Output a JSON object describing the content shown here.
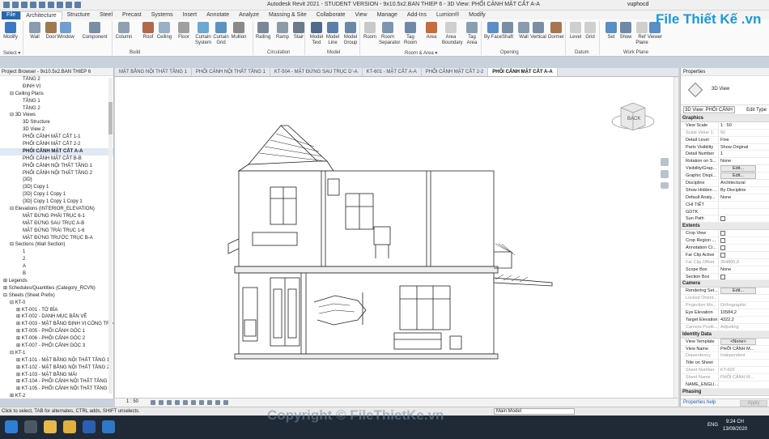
{
  "window": {
    "title": "Autodesk Revit 2021 - STUDENT VERSION - 9x10.5x2.BAN THIEP 6 - 3D View: PHỐI CẢNH MẶT CẮT A-A",
    "user": "vuphocd"
  },
  "ribbon": {
    "tabs": [
      "File",
      "Architecture",
      "Structure",
      "Steel",
      "Precast",
      "Systems",
      "Insert",
      "Annotate",
      "Analyze",
      "Massing & Site",
      "Collaborate",
      "View",
      "Manage",
      "Add-Ins",
      "Lumion®",
      "Modify"
    ],
    "active_tab": "Architecture",
    "buttons": [
      {
        "label": "Modify",
        "color": "#3b78c4"
      },
      {
        "label": "Wall",
        "color": "#8a9bb0"
      },
      {
        "label": "Door",
        "color": "#a07a4e"
      },
      {
        "label": "Window",
        "color": "#6e9fd0"
      },
      {
        "label": "Component",
        "color": "#7a8fa6"
      },
      {
        "label": "Column",
        "color": "#8fa0b3"
      },
      {
        "label": "Roof",
        "color": "#b06a4a"
      },
      {
        "label": "Ceiling",
        "color": "#9ab0c6"
      },
      {
        "label": "Floor",
        "color": "#a0a0a0"
      },
      {
        "label": "Curtain System",
        "color": "#6aa8d6"
      },
      {
        "label": "Curtain Grid",
        "color": "#5c93c2"
      },
      {
        "label": "Mullion",
        "color": "#8a8a8a"
      },
      {
        "label": "Railing",
        "color": "#7b8797"
      },
      {
        "label": "Ramp",
        "color": "#8d9aa8"
      },
      {
        "label": "Stair",
        "color": "#6b7b8d"
      },
      {
        "label": "Model Text",
        "color": "#4f6a8a"
      },
      {
        "label": "Model Line",
        "color": "#5b7fa8"
      },
      {
        "label": "Model Group",
        "color": "#6c88a8"
      },
      {
        "label": "Room",
        "color": "#c9c9c9"
      },
      {
        "label": "Room Separator",
        "color": "#7d95b0"
      },
      {
        "label": "Tag Room",
        "color": "#6f8aa9"
      },
      {
        "label": "Area",
        "color": "#c96a3a"
      },
      {
        "label": "Area Boundary",
        "color": "#cfcfcf"
      },
      {
        "label": "Tag Area",
        "color": "#8a9fb6"
      },
      {
        "label": "By Face",
        "color": "#5a8ec6"
      },
      {
        "label": "Shaft",
        "color": "#7a8fa6"
      },
      {
        "label": "Wall",
        "color": "#8a9bb0"
      },
      {
        "label": "Vertical",
        "color": "#7a8fa6"
      },
      {
        "label": "Dormer",
        "color": "#a9754f"
      },
      {
        "label": "Level",
        "color": "#cfcfcf"
      },
      {
        "label": "Grid",
        "color": "#cfcfcf"
      },
      {
        "label": "Set",
        "color": "#5a8ec6"
      },
      {
        "label": "Show",
        "color": "#6f8aa9"
      },
      {
        "label": "Ref Plane",
        "color": "#cfcfcf"
      },
      {
        "label": "Viewer",
        "color": "#5a8ec6"
      }
    ],
    "panels": [
      "Select ▾",
      "Build",
      "Circulation",
      "Model",
      "Room & Area ▾",
      "Opening",
      "Datum",
      "Work Plane"
    ]
  },
  "project_browser": {
    "title": "Project Browser - 9x10.5x2.BAN THIEP 6",
    "items": [
      {
        "text": "TẦNG 2",
        "indent": 3
      },
      {
        "text": "ĐỊNH VỊ",
        "indent": 3
      },
      {
        "text": "⊟ Ceiling Plans",
        "indent": 1
      },
      {
        "text": "TẦNG 1",
        "indent": 3
      },
      {
        "text": "TẦNG 2",
        "indent": 3
      },
      {
        "text": "⊟ 3D Views",
        "indent": 1
      },
      {
        "text": "3D Structure",
        "indent": 3
      },
      {
        "text": "3D View 2",
        "indent": 3
      },
      {
        "text": "PHỐI CẢNH MẶT CẮT 1-1",
        "indent": 3
      },
      {
        "text": "PHỐI CẢNH MẶT CẮT 2-2",
        "indent": 3
      },
      {
        "text": "PHỐI CẢNH MẶT CẮT A-A",
        "indent": 3,
        "selected": true
      },
      {
        "text": "PHỐI CẢNH MẶT CẮT B-B",
        "indent": 3
      },
      {
        "text": "PHỐI CẢNH NỘI THẤT TẦNG 1",
        "indent": 3
      },
      {
        "text": "PHỐI CẢNH NỘI THẤT TẦNG 2",
        "indent": 3
      },
      {
        "text": "{3D}",
        "indent": 3
      },
      {
        "text": "{3D} Copy 1",
        "indent": 3
      },
      {
        "text": "{3D} Copy 1 Copy 1",
        "indent": 3
      },
      {
        "text": "{3D} Copy 1 Copy 1 Copy 1",
        "indent": 3
      },
      {
        "text": "⊟ Elevations (INTERIOR_ELEVATION)",
        "indent": 1
      },
      {
        "text": "MẶT ĐỨNG PHẢI TRỤC 6-1",
        "indent": 3
      },
      {
        "text": "MẶT ĐỨNG SAU TRỤC A-B",
        "indent": 3
      },
      {
        "text": "MẶT ĐỨNG TRÁI TRỤC 1-6",
        "indent": 3
      },
      {
        "text": "MẶT ĐỨNG TRƯỚC TRỤC B-A",
        "indent": 3
      },
      {
        "text": "⊟ Sections (Wall Section)",
        "indent": 1
      },
      {
        "text": "1",
        "indent": 3
      },
      {
        "text": "2",
        "indent": 3
      },
      {
        "text": "A",
        "indent": 3
      },
      {
        "text": "B",
        "indent": 3
      },
      {
        "text": "⊞ Legends",
        "indent": 0
      },
      {
        "text": "⊞ Schedules/Quantities (Category_RCVN)",
        "indent": 0
      },
      {
        "text": "⊟ Sheets (Sheet Prefix)",
        "indent": 0
      },
      {
        "text": "⊟ KT-0",
        "indent": 1
      },
      {
        "text": "⊞ KT-001 - TỜ BÌA",
        "indent": 2
      },
      {
        "text": "⊞ KT-002 - DANH MỤC BẢN VẼ",
        "indent": 2
      },
      {
        "text": "⊞ KT-003 - MẶT BẰNG ĐỊNH VỊ CÔNG TRÌNH",
        "indent": 2
      },
      {
        "text": "⊞ KT-005 - PHỐI CẢNH GÓC 1",
        "indent": 2
      },
      {
        "text": "⊞ KT-006 - PHỐI CẢNH GÓC 2",
        "indent": 2
      },
      {
        "text": "⊞ KT-007 - PHỐI CẢNH GÓC 3",
        "indent": 2
      },
      {
        "text": "⊟ KT-1",
        "indent": 1
      },
      {
        "text": "⊞ KT-101 - MẶT BẰNG NỘI THẤT TẦNG 1",
        "indent": 2
      },
      {
        "text": "⊞ KT-102 - MẶT BẰNG NỘI THẤT TẦNG 2",
        "indent": 2
      },
      {
        "text": "⊞ KT-103 - MẶT BẰNG MÁI",
        "indent": 2
      },
      {
        "text": "⊞ KT-104 - PHỐI CẢNH NỘI THẤT TẦNG 1",
        "indent": 2
      },
      {
        "text": "⊞ KT-105 - PHỐI CẢNH NỘI THẤT TẦNG 2",
        "indent": 2
      },
      {
        "text": "⊞ KT-2",
        "indent": 1
      }
    ]
  },
  "view_tabs": [
    {
      "label": "MẶT BẰNG NỘI THẤT TẦNG 1",
      "active": false
    },
    {
      "label": "PHỐI CẢNH NỘI THẤT TẦNG 1",
      "active": false
    },
    {
      "label": "KT-504 - MẶT ĐỨNG SAU TRỤC D'-A",
      "active": false
    },
    {
      "label": "KT-601 - MẶT CẮT A-A",
      "active": false
    },
    {
      "label": "PHỐI CẢNH MẶT CẮT 2-2",
      "active": false
    },
    {
      "label": "PHỐI CẢNH MẶT CẮT A-A",
      "active": true
    }
  ],
  "viewcube": {
    "face": "BACK"
  },
  "view_control": {
    "scale": "1 : 50"
  },
  "properties": {
    "title": "Properties",
    "type_name": "3D View",
    "instance_selector": "3D View: PHỐI CẢNH",
    "edit_type": "Edit Type",
    "rows": [
      {
        "group": "Graphics"
      },
      {
        "k": "View Scale",
        "v": "1 : 50"
      },
      {
        "k": "Scale Value 1:",
        "v": "50",
        "gray": true
      },
      {
        "k": "Detail Level",
        "v": "Fine"
      },
      {
        "k": "Parts Visibility",
        "v": "Show Original"
      },
      {
        "k": "Detail Number",
        "v": "1"
      },
      {
        "k": "Rotation on S...",
        "v": "None"
      },
      {
        "k": "Visibility/Grap...",
        "btn": "Edit..."
      },
      {
        "k": "Graphic Displ...",
        "btn": "Edit..."
      },
      {
        "k": "Discipline",
        "v": "Architectural"
      },
      {
        "k": "Show Hidden ...",
        "v": "By Discipline"
      },
      {
        "k": "Default Analy...",
        "v": "None"
      },
      {
        "k": "CHI TIẾT",
        "v": ""
      },
      {
        "k": "GDTK",
        "v": ""
      },
      {
        "k": "Sun Path",
        "check": true
      },
      {
        "group": "Extents"
      },
      {
        "k": "Crop View",
        "check": true
      },
      {
        "k": "Crop Region ...",
        "check": true
      },
      {
        "k": "Annotation Cr...",
        "check": true
      },
      {
        "k": "Far Clip Active",
        "check": true
      },
      {
        "k": "Far Clip Offset",
        "v": "304800,0",
        "gray": true
      },
      {
        "k": "Scope Box",
        "v": "None"
      },
      {
        "k": "Section Box",
        "check": true
      },
      {
        "group": "Camera"
      },
      {
        "k": "Rendering Set...",
        "btn": "Edit..."
      },
      {
        "k": "Locked Orient...",
        "v": "",
        "gray": true
      },
      {
        "k": "Projection Mo...",
        "v": "Orthographic",
        "gray": true
      },
      {
        "k": "Eye Elevation",
        "v": "10584,2"
      },
      {
        "k": "Target Elevation",
        "v": "4322,2"
      },
      {
        "k": "Camera Positi...",
        "v": "Adjusting",
        "gray": true
      },
      {
        "group": "Identity Data"
      },
      {
        "k": "View Template",
        "btn": "<None>"
      },
      {
        "k": "View Name",
        "v": "PHỐI CẢNH M..."
      },
      {
        "k": "Dependency",
        "v": "Independent",
        "gray": true
      },
      {
        "k": "Title on Sheet",
        "v": ""
      },
      {
        "k": "Sheet Number",
        "v": "KT-602",
        "gray": true
      },
      {
        "k": "Sheet Name",
        "v": "PHỐI CẢNH M...",
        "gray": true
      },
      {
        "k": "NAME_ENGLI...",
        "v": ""
      },
      {
        "group": "Phasing"
      }
    ],
    "help_link": "Properties help",
    "apply": "Apply"
  },
  "status_bar": {
    "message": "Click to select, TAB for alternates, CTRL adds, SHIFT unselects.",
    "model": "Main Model"
  },
  "taskbar": {
    "lang": "ENG",
    "time": "9:24 CH",
    "date": "13/09/2020"
  },
  "watermark": {
    "logo": "File Thiết Kế .vn",
    "copyright": "Copyright © FileThietKe.vn"
  }
}
